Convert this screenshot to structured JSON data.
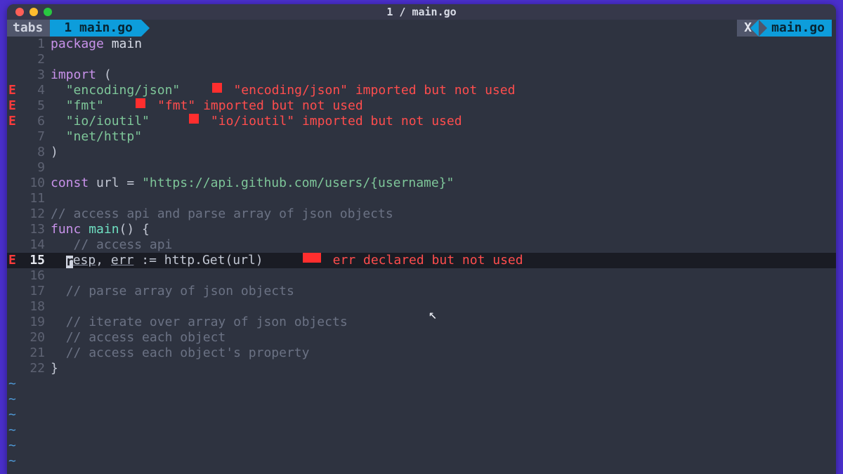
{
  "window": {
    "title": "1 / main.go"
  },
  "tabbar": {
    "tabs_label": "tabs",
    "active_tab": "1 main.go",
    "close_label": "X",
    "right_tab": "main.go"
  },
  "gutter": {
    "error_sign": "E"
  },
  "lines": [
    {
      "n": 1,
      "sign": "",
      "segs": [
        [
          "kw",
          "package "
        ],
        [
          "type",
          "main"
        ]
      ]
    },
    {
      "n": 2,
      "sign": "",
      "segs": []
    },
    {
      "n": 3,
      "sign": "",
      "segs": [
        [
          "kw",
          "import "
        ],
        [
          "ident",
          "("
        ]
      ]
    },
    {
      "n": 4,
      "sign": "E",
      "segs": [
        [
          "ident",
          "  "
        ],
        [
          "str",
          "\"encoding/json\""
        ]
      ],
      "err": "\"encoding/json\" imported but not used",
      "pad": "    "
    },
    {
      "n": 5,
      "sign": "E",
      "segs": [
        [
          "ident",
          "  "
        ],
        [
          "str",
          "\"fmt\""
        ]
      ],
      "err": "\"fmt\" imported but not used",
      "pad": "    "
    },
    {
      "n": 6,
      "sign": "E",
      "segs": [
        [
          "ident",
          "  "
        ],
        [
          "str",
          "\"io/ioutil\""
        ]
      ],
      "err": "\"io/ioutil\" imported but not used",
      "pad": "     "
    },
    {
      "n": 7,
      "sign": "",
      "segs": [
        [
          "ident",
          "  "
        ],
        [
          "str",
          "\"net/http\""
        ]
      ]
    },
    {
      "n": 8,
      "sign": "",
      "segs": [
        [
          "ident",
          ")"
        ]
      ]
    },
    {
      "n": 9,
      "sign": "",
      "segs": []
    },
    {
      "n": 10,
      "sign": "",
      "segs": [
        [
          "kw",
          "const "
        ],
        [
          "ident",
          "url = "
        ],
        [
          "str",
          "\"https://api.github.com/users/{username}\""
        ]
      ]
    },
    {
      "n": 11,
      "sign": "",
      "segs": []
    },
    {
      "n": 12,
      "sign": "",
      "segs": [
        [
          "comment",
          "// access api and parse array of json objects"
        ]
      ]
    },
    {
      "n": 13,
      "sign": "",
      "segs": [
        [
          "kw",
          "func "
        ],
        [
          "funcname",
          "main"
        ],
        [
          "ident",
          "() {"
        ]
      ]
    },
    {
      "n": 14,
      "sign": "",
      "segs": [
        [
          "ident",
          "   "
        ],
        [
          "comment",
          "// access api"
        ]
      ]
    },
    {
      "n": 15,
      "sign": "E",
      "current": true,
      "segs": [
        [
          "ident",
          "  "
        ],
        [
          "cursor",
          "r"
        ],
        [
          "under",
          "esp"
        ],
        [
          "ident",
          ", "
        ],
        [
          "under",
          "err"
        ],
        [
          "ident",
          " := http.Get(url)"
        ]
      ],
      "err": "err declared but not used",
      "pad": "     ",
      "long_sq": true
    },
    {
      "n": 16,
      "sign": "",
      "segs": []
    },
    {
      "n": 17,
      "sign": "",
      "segs": [
        [
          "ident",
          "  "
        ],
        [
          "comment",
          "// parse array of json objects"
        ]
      ]
    },
    {
      "n": 18,
      "sign": "",
      "segs": []
    },
    {
      "n": 19,
      "sign": "",
      "segs": [
        [
          "ident",
          "  "
        ],
        [
          "comment",
          "// iterate over array of json objects"
        ]
      ]
    },
    {
      "n": 20,
      "sign": "",
      "segs": [
        [
          "ident",
          "  "
        ],
        [
          "comment",
          "// access each object"
        ]
      ]
    },
    {
      "n": 21,
      "sign": "",
      "segs": [
        [
          "ident",
          "  "
        ],
        [
          "comment",
          "// access each object's property"
        ]
      ]
    },
    {
      "n": 22,
      "sign": "",
      "segs": [
        [
          "ident",
          "}"
        ]
      ]
    }
  ],
  "tilde_rows": 6,
  "tilde_char": "~",
  "mouse_glyph": "↖"
}
